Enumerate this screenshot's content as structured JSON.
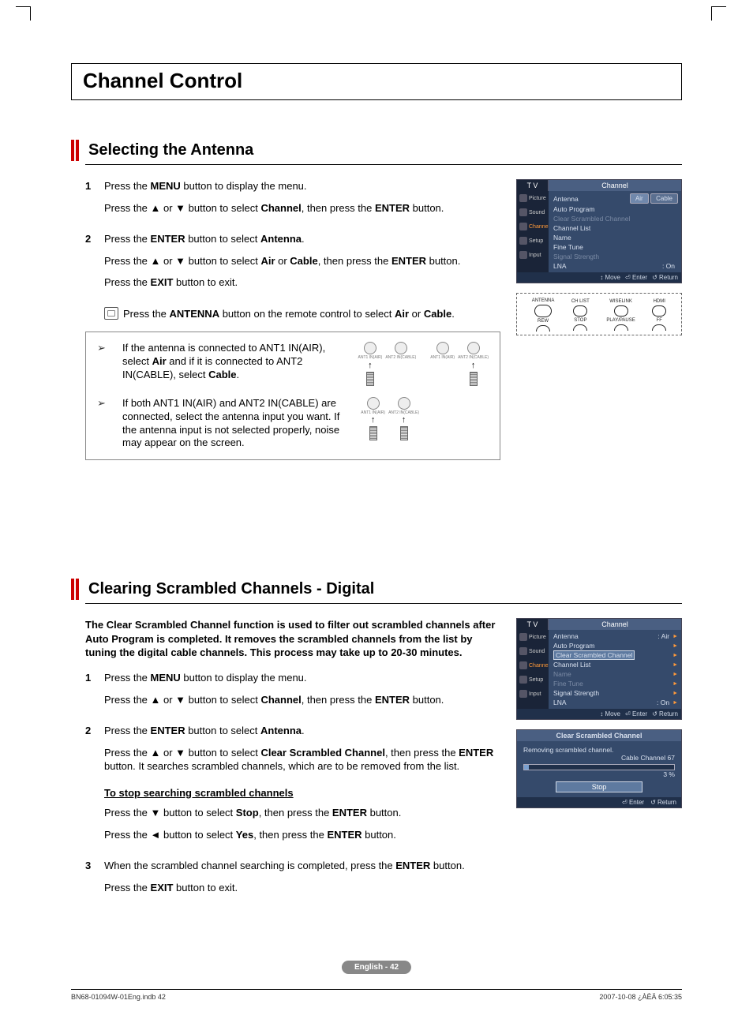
{
  "crop": true,
  "chapter_title": "Channel Control",
  "section1": {
    "title": "Selecting the Antenna",
    "steps": [
      {
        "num": "1",
        "lines": [
          "Press the <b>MENU</b> button to display the menu.",
          "Press the ▲ or ▼ button to select <b>Channel</b>, then press the <b>ENTER</b> button."
        ]
      },
      {
        "num": "2",
        "lines": [
          "Press the <b>ENTER</b> button to select <b>Antenna</b>.",
          "Press the ▲ or ▼ button to select <b>Air</b> or <b>Cable</b>, then press the <b>ENTER</b> button.",
          "Press the <b>EXIT</b> button to exit."
        ]
      }
    ],
    "remote_note": "Press the <b>ANTENNA</b> button on the remote control to select <b>Air</b> or <b>Cable</b>.",
    "callouts": [
      "If the antenna is connected to ANT1 IN(AIR), select <b>Air</b> and if it is connected to ANT2 IN(CABLE), select <b>Cable</b>.",
      "If both ANT1 IN(AIR) and ANT2 IN(CABLE) are connected, select the antenna input you want. If the antenna input is not selected properly, noise may appear on the screen."
    ],
    "ant_labels": {
      "a": "ANT1 IN(AIR)",
      "b": "ANT2 IN(CABLE)"
    },
    "osd": {
      "tv": "T V",
      "tab": "Channel",
      "side": [
        "Picture",
        "Sound",
        "Channel",
        "Setup",
        "Input"
      ],
      "side_selected": 2,
      "rows": [
        {
          "label": "Antenna",
          "value": "",
          "pills": [
            "Air",
            "Cable"
          ],
          "dim": false,
          "tri": false,
          "hl": true
        },
        {
          "label": "Auto Program",
          "value": "",
          "dim": false,
          "tri": false
        },
        {
          "label": "Clear Scrambled Channel",
          "value": "",
          "dim": true,
          "tri": false
        },
        {
          "label": "Channel List",
          "value": "",
          "dim": false,
          "tri": false
        },
        {
          "label": "Name",
          "value": "",
          "dim": false,
          "tri": false
        },
        {
          "label": "Fine Tune",
          "value": "",
          "dim": false,
          "tri": false
        },
        {
          "label": "Signal Strength",
          "value": "",
          "dim": true,
          "tri": false
        },
        {
          "label": "LNA",
          "value": ": On",
          "dim": false,
          "tri": false
        }
      ],
      "foot": [
        "Move",
        "Enter",
        "Return"
      ],
      "foot_icons": [
        "↕",
        "⏎",
        "↺"
      ]
    },
    "remote_strip": {
      "labels": [
        "ANTENNA",
        "CH LIST",
        "WISELINK",
        "HDMI"
      ],
      "bottom": [
        "REW",
        "STOP",
        "PLAY/PAUSE",
        "FF"
      ]
    }
  },
  "section2": {
    "title": "Clearing Scrambled Channels - Digital",
    "intro": "The Clear Scrambled Channel function is used to filter out scrambled channels after Auto Program is completed. It removes the scrambled channels from the list by tuning the digital cable channels. This process may take up to 20-30 minutes.",
    "steps": [
      {
        "num": "1",
        "lines": [
          "Press the <b>MENU</b> button to display the menu.",
          "Press the ▲ or ▼ button to select <b>Channel</b>, then press the <b>ENTER</b> button."
        ]
      },
      {
        "num": "2",
        "lines": [
          "Press the <b>ENTER</b> button to select <b>Antenna</b>.",
          "Press the ▲ or ▼ button to select <b>Clear Scrambled Channel</b>, then press the <b>ENTER</b> button. It searches scrambled channels, which are to be removed from the list."
        ],
        "sub_title": "To stop searching scrambled channels",
        "sub_lines": [
          "Press the ▼ button to select <b>Stop</b>, then press the <b>ENTER</b> button.",
          "Press the ◄ button to select <b>Yes</b>, then press the <b>ENTER</b> button."
        ]
      },
      {
        "num": "3",
        "lines": [
          "When the scrambled channel searching is completed, press the <b>ENTER</b> button.",
          "Press the <b>EXIT</b> button to exit."
        ]
      }
    ],
    "osd": {
      "tv": "T V",
      "tab": "Channel",
      "side": [
        "Picture",
        "Sound",
        "Channel",
        "Setup",
        "Input"
      ],
      "side_selected": 2,
      "rows": [
        {
          "label": "Antenna",
          "value": ": Air",
          "tri": true
        },
        {
          "label": "Auto Program",
          "value": "",
          "tri": true
        },
        {
          "label": "Clear Scrambled Channel",
          "value": "",
          "tri": true,
          "sel": true
        },
        {
          "label": "Channel List",
          "value": "",
          "tri": true
        },
        {
          "label": "Name",
          "value": "",
          "tri": true,
          "dim": true
        },
        {
          "label": "Fine Tune",
          "value": "",
          "tri": true,
          "dim": true
        },
        {
          "label": "Signal Strength",
          "value": "",
          "tri": true
        },
        {
          "label": "LNA",
          "value": ": On",
          "tri": true
        }
      ],
      "foot": [
        "Move",
        "Enter",
        "Return"
      ],
      "foot_icons": [
        "↕",
        "⏎",
        "↺"
      ]
    },
    "popup": {
      "title": "Clear Scrambled Channel",
      "msg": "Removing scrambled channel.",
      "sub": "Cable Channel 67",
      "pct": "3 %",
      "stop": "Stop",
      "foot": [
        "Enter",
        "Return"
      ],
      "foot_icons": [
        "⏎",
        "↺"
      ]
    }
  },
  "page_badge": "English - 42",
  "footer_left": "BN68-01094W-01Eng.indb   42",
  "footer_right": "2007-10-08   ¿ÀÈÄ 6:05:35"
}
